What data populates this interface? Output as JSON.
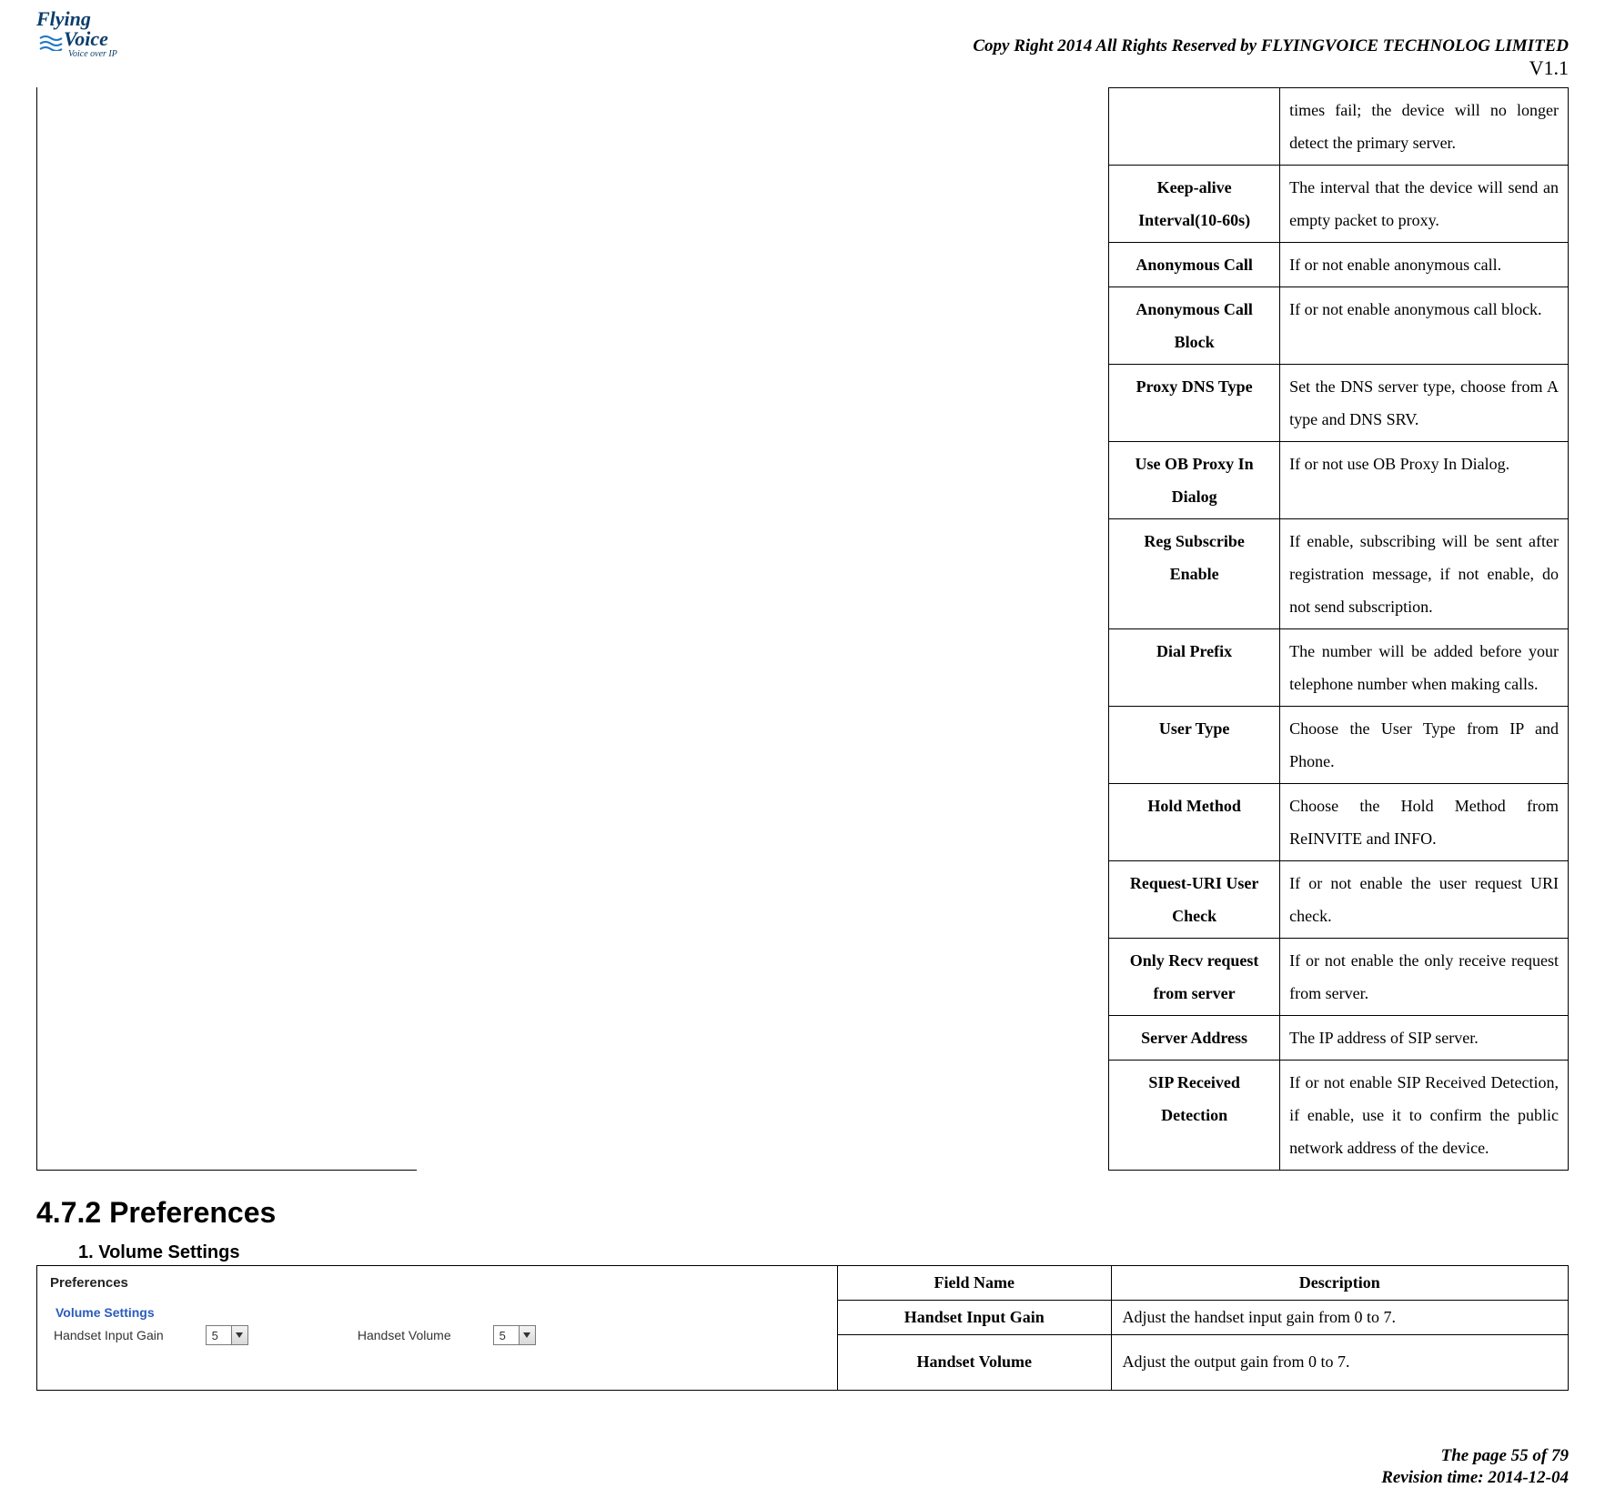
{
  "header": {
    "logo_line1": "Flying",
    "logo_line2": "Voice",
    "logo_sub": "Voice over IP",
    "copyright": "Copy Right 2014 All Rights Reserved by FLYINGVOICE TECHNOLOG LIMITED",
    "version": "V1.1"
  },
  "top_table": [
    {
      "name": "",
      "desc": "times fail; the device will no longer detect the primary server."
    },
    {
      "name": "Keep-alive Interval(10-60s)",
      "desc": "The interval that the device will send an empty packet to proxy."
    },
    {
      "name": "Anonymous Call",
      "desc": "If or not enable anonymous call."
    },
    {
      "name": "Anonymous Call Block",
      "desc": "If or not enable anonymous call block."
    },
    {
      "name": "Proxy DNS Type",
      "desc": "Set the DNS server type, choose from A type and DNS SRV."
    },
    {
      "name": "Use OB Proxy In Dialog",
      "desc": "If or not use OB Proxy In Dialog."
    },
    {
      "name": "Reg Subscribe Enable",
      "desc": "If enable, subscribing will be sent after registration message, if not enable, do not send subscription."
    },
    {
      "name": "Dial Prefix",
      "desc": "The number will be added before your telephone number when making calls."
    },
    {
      "name": "User Type",
      "desc": "Choose the User Type from IP and Phone."
    },
    {
      "name": "Hold Method",
      "desc": "Choose the Hold Method from ReINVITE and INFO."
    },
    {
      "name": "Request-URI User Check",
      "desc": "If or not enable the user request URI check."
    },
    {
      "name": "Only Recv request from server",
      "desc": "If or not enable the only receive request from server."
    },
    {
      "name": "Server Address",
      "desc": "The IP address of SIP server."
    },
    {
      "name": "SIP Received Detection",
      "desc": "If or not enable SIP Received Detection, if enable, use it to confirm the public network address of the device."
    }
  ],
  "section": {
    "heading": "4.7.2 Preferences",
    "subheading": "1.  Volume Settings"
  },
  "preferences_screenshot": {
    "panel_title": "Preferences",
    "fieldset_label": "Volume Settings",
    "handset_input_gain_label": "Handset Input Gain",
    "handset_input_gain_value": "5",
    "handset_volume_label": "Handset Volume",
    "handset_volume_value": "5"
  },
  "vol_table": {
    "header_name": "Field Name",
    "header_desc": "Description",
    "rows": [
      {
        "name": "Handset Input Gain",
        "desc": "Adjust the handset input gain from 0 to 7."
      },
      {
        "name": "Handset Volume",
        "desc": "Adjust the output gain from 0 to 7."
      }
    ]
  },
  "footer": {
    "page": "The page 55 of 79",
    "revision": "Revision time: 2014-12-04"
  }
}
